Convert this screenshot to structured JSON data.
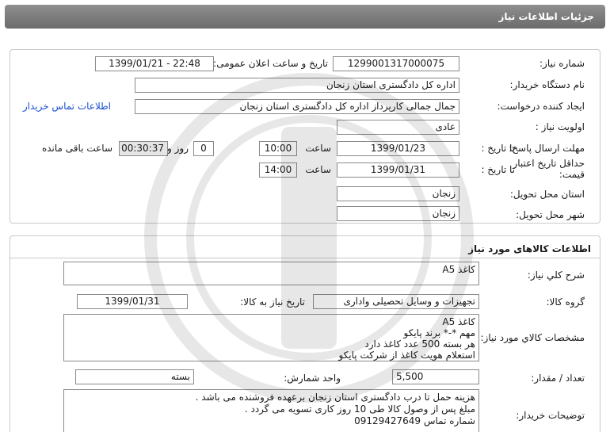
{
  "header": {
    "title": "جزئیات اطلاعات نیاز"
  },
  "need_info": {
    "need_number_label": "شماره نیاز:",
    "need_number": "1299001317000075",
    "announce_label": "تاریخ و ساعت اعلان عمومی:",
    "announce_value": "1399/01/21 - 22:48",
    "buyer_org_label": "نام دستگاه خریدار:",
    "buyer_org": "اداره کل دادگستری استان زنجان",
    "creator_label": "ایجاد کننده درخواست:",
    "creator": "جمال جمالی کارپرداز اداره کل دادگستری استان زنجان",
    "contact_link": "اطلاعات تماس خریدار",
    "priority_label": "اولویت نیاز :",
    "priority": "عادی",
    "reply_deadline_label": "مهلت ارسال پاسخ:",
    "to_date_label": "تا تاریخ :",
    "reply_date": "1399/01/23",
    "time_label": "ساعت",
    "reply_time": "10:00",
    "days": "0",
    "days_label": "روز و",
    "remaining_time": "00:30:37",
    "remaining_label": "ساعت باقی مانده",
    "validity_label_1": "حداقل تاریخ اعتبار",
    "validity_label_2": "قیمت:",
    "validity_date": "1399/01/31",
    "validity_time": "14:00",
    "province_label": "استان محل تحویل:",
    "province": "زنجان",
    "city_label": "شهر محل تحویل:",
    "city": "زنجان"
  },
  "goods": {
    "section_title": "اطلاعات کالاهای مورد نیاز",
    "summary_label": "شرح کلي نياز:",
    "summary": "کاغذ A5",
    "group_label": "گروه کالا:",
    "group": "تجهیزات و وسایل تحصیلی واداری",
    "need_date_label": "تاریخ نیاز به کالا:",
    "need_date": "1399/01/31",
    "spec_label": "مشخصات کالاي مورد نياز:",
    "spec_lines": [
      "کاغذ A5",
      "مهم *-* برند پایکو",
      "هر بسته 500 عدد کاغذ دارد",
      "استعلام هویت کاغذ از شرکت پایکو"
    ],
    "qty_label": "تعداد / مقدار:",
    "qty": "5,500",
    "unit_label": "واحد شمارش:",
    "unit": "بسته",
    "buyer_notes_label": "توضیحات خریدار:",
    "buyer_notes": [
      "هزینه حمل تا درب دادگستری استان زنجان برعهده فروشنده می باشد .",
      "مبلغ پس از وصول کالا طی 10 روز کاری تسویه می گردد .",
      "شماره تماس 09129427649"
    ]
  }
}
